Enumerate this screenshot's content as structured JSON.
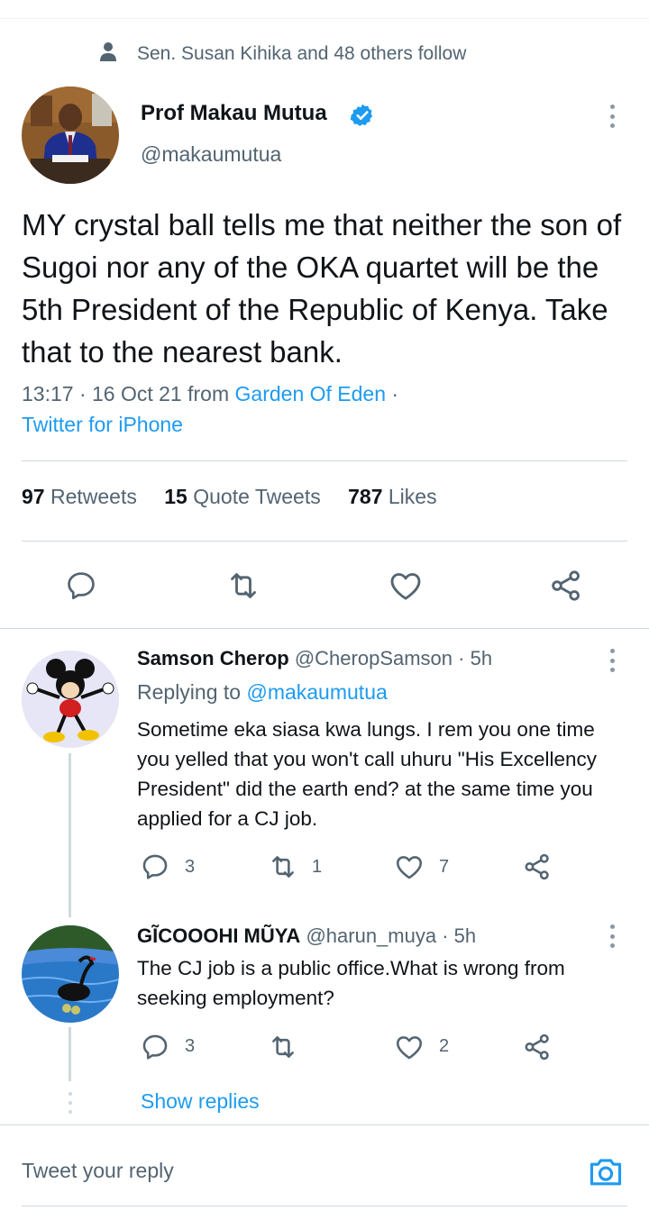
{
  "social_context": {
    "text": "Sen. Susan Kihika and 48 others follow"
  },
  "tweet": {
    "author_name": "Prof Makau Mutua",
    "author_handle": "@makaumutua",
    "verified": true,
    "body": "MY crystal ball tells me that neither the son of Sugoi nor any of the OKA quartet will be the 5th President of the Republic of Kenya.  Take that to the nearest bank.",
    "time": "13:17 · 16 Oct 21 from ",
    "location": "Garden Of Eden",
    "sep": " ·",
    "source": "Twitter for iPhone"
  },
  "stats": {
    "retweets_count": "97",
    "retweets_label": "Retweets",
    "quotes_count": "15",
    "quotes_label": "Quote Tweets",
    "likes_count": "787",
    "likes_label": "Likes"
  },
  "replies": [
    {
      "name": "Samson Cherop",
      "handle": "@CheropSamson",
      "time": "· 5h",
      "replying_to_label": "Replying to ",
      "replying_to_handle": "@makaumutua",
      "text": "Sometime eka siasa kwa lungs. I rem you one time you yelled that you won't call uhuru \"His Excellency President\" did the earth end? at the same time you applied for a CJ job.",
      "reply_count": "3",
      "retweet_count": "1",
      "like_count": "7"
    },
    {
      "name": "GĨCOOOHI MŨYA",
      "handle": "@harun_muya",
      "time": "· 5h",
      "text": "The CJ job is a public office.What is wrong from seeking employment?",
      "reply_count": "3",
      "retweet_count": "",
      "like_count": "2"
    }
  ],
  "show_replies": "Show replies",
  "compose": {
    "placeholder": "Tweet your reply"
  },
  "colors": {
    "accent": "#1d9bf0",
    "secondary_text": "#536471",
    "divider": "#cfd9de"
  }
}
